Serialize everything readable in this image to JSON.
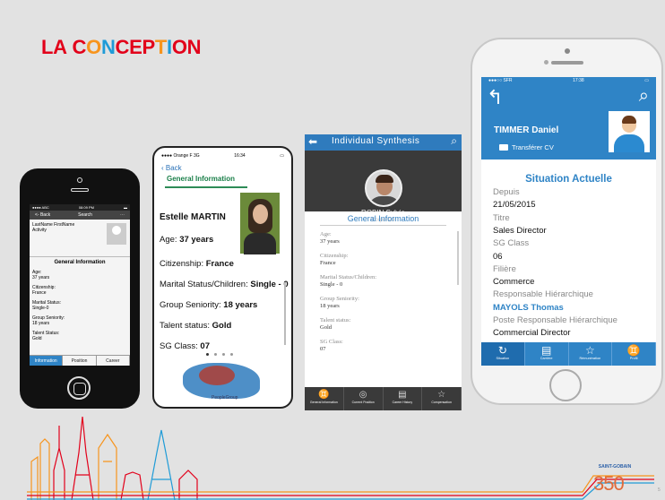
{
  "slide": {
    "title_letters": [
      {
        "ch": "L",
        "color": "#e2001a"
      },
      {
        "ch": "A",
        "color": "#e2001a"
      },
      {
        "ch": " ",
        "color": "#e2001a"
      },
      {
        "ch": "C",
        "color": "#e2001a"
      },
      {
        "ch": "O",
        "color": "#f7941d"
      },
      {
        "ch": "N",
        "color": "#1f9bd7"
      },
      {
        "ch": "C",
        "color": "#e2001a"
      },
      {
        "ch": "E",
        "color": "#e2001a"
      },
      {
        "ch": "P",
        "color": "#e2001a"
      },
      {
        "ch": "T",
        "color": "#f7941d"
      },
      {
        "ch": "I",
        "color": "#1f9bd7"
      },
      {
        "ch": "O",
        "color": "#e2001a"
      },
      {
        "ch": "N",
        "color": "#e2001a"
      }
    ],
    "page_number": "5",
    "logo_brand": "SAINT-GOBAIN",
    "logo_number": "350"
  },
  "phone1": {
    "status_left": "●●●● ABC",
    "status_time": "08:09 PM",
    "nav_back": "<- Back",
    "nav_search": "Search",
    "name_line1": "LastName FirstName",
    "name_line2": "Activity",
    "section": "General Information",
    "fields": [
      {
        "label": "Age:",
        "value": "37 years"
      },
      {
        "label": "Citizenship:",
        "value": "France"
      },
      {
        "label": "Marital Status:",
        "value": "Single-0"
      },
      {
        "label": "Group Seniority:",
        "value": "18 years"
      },
      {
        "label": "Talent Status:",
        "value": "Gold"
      }
    ],
    "tabs": [
      "Information",
      "Position",
      "Career"
    ]
  },
  "phone2": {
    "status_left": "●●●● Orange F  3G",
    "status_time": "16:34",
    "back": "‹ Back",
    "section": "General Information",
    "name": "Estelle MARTIN",
    "rows": [
      {
        "label": "Age: ",
        "value": "37 years"
      },
      {
        "label": "Citizenship: ",
        "value": "France"
      },
      {
        "label": "Marital Status/Children: ",
        "value": "Single - 0"
      },
      {
        "label": "Group Seniority: ",
        "value": "18 years"
      },
      {
        "label": "Talent status: ",
        "value": "Gold"
      },
      {
        "label": "SG Class: ",
        "value": "07"
      }
    ],
    "footer": "PeopleGroup"
  },
  "phone3": {
    "header": "Individual Synthesis",
    "name": "ROBIN Sylvie",
    "subtitle": "Corporate",
    "section": "General Information",
    "fields": [
      {
        "label": "Age:",
        "value": "37 years"
      },
      {
        "label": "Citizenship:",
        "value": "France"
      },
      {
        "label": "Marital Status/Children:",
        "value": "Single - 0"
      },
      {
        "label": "Group Seniority:",
        "value": "18 years"
      },
      {
        "label": "Talent status:",
        "value": "Gold"
      },
      {
        "label": "SG Class:",
        "value": "07"
      }
    ],
    "tabs": [
      "General Information",
      "Current Position",
      "Career History",
      "Compensation"
    ]
  },
  "phone4": {
    "carrier": "●●●○○ SFR",
    "time": "17:38",
    "name": "TIMMER Daniel",
    "cv_label": "Transférer CV",
    "situation_title": "Situation Actuelle",
    "rows": [
      {
        "text": "Depuis",
        "kind": "lab"
      },
      {
        "text": "21/05/2015",
        "kind": "val"
      },
      {
        "text": "Titre",
        "kind": "lab"
      },
      {
        "text": "Sales Director",
        "kind": "val"
      },
      {
        "text": "SG Class",
        "kind": "lab"
      },
      {
        "text": "06",
        "kind": "val"
      },
      {
        "text": "Filière",
        "kind": "lab"
      },
      {
        "text": "Commerce",
        "kind": "val"
      },
      {
        "text": "Responsable Hiérarchique",
        "kind": "lab"
      },
      {
        "text": "MAYOLS Thomas",
        "kind": "lnk"
      },
      {
        "text": "Poste Responsable Hiérarchique",
        "kind": "lab"
      },
      {
        "text": "Commercial Director",
        "kind": "val"
      }
    ],
    "tabs": [
      "Situation",
      "Carrière",
      "Rémunération",
      "Profil"
    ]
  }
}
